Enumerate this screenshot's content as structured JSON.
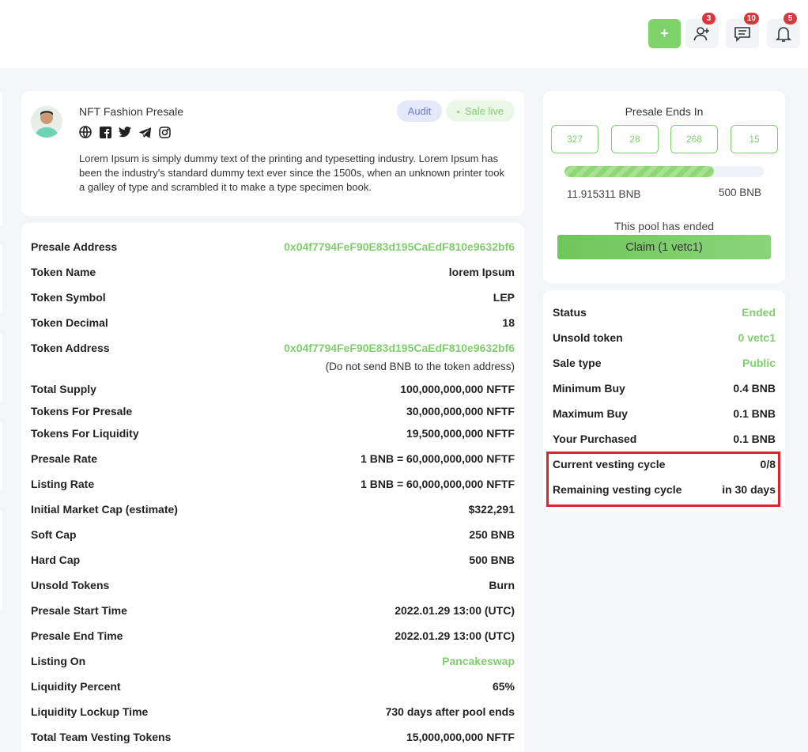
{
  "topbar": {
    "add_label": "+",
    "friend_badge": "3",
    "message_badge": "10",
    "notification_badge": "5"
  },
  "project": {
    "name": "NFT Fashion Presale",
    "audit_label": "Audit",
    "live_label": "Sale live",
    "description": "Lorem Ipsum is simply dummy text of the printing and typesetting industry. Lorem Ipsum has been the industry's standard dummy text ever since the 1500s, when an unknown printer took a galley of type and scrambled it to make a type specimen book.",
    "socials": [
      "globe-icon",
      "facebook-icon",
      "twitter-icon",
      "telegram-icon",
      "instagram-icon"
    ]
  },
  "details": {
    "rows": [
      {
        "key": "Presale Address",
        "value": "0x04f7794FeF90E83d195CaEdF810e9632bf6"
      },
      {
        "key": "Token Name",
        "value": "lorem Ipsum"
      },
      {
        "key": "Token Symbol",
        "value": "LEP"
      },
      {
        "key": "Token Decimal",
        "value": "18"
      },
      {
        "key": "Token Address",
        "value": "0x04f7794FeF90E83d195CaEdF810e9632bf6"
      },
      {
        "key": "Total Supply",
        "value": "100,000,000,000 NFTF"
      },
      {
        "key": "Tokens For Presale",
        "value": "30,000,000,000 NFTF"
      },
      {
        "key": "Tokens For Liquidity",
        "value": "19,500,000,000 NFTF"
      },
      {
        "key": "Presale Rate",
        "value": "1 BNB = 60,000,000,000 NFTF"
      },
      {
        "key": "Listing Rate",
        "value": "1 BNB = 60,000,000,000 NFTF"
      },
      {
        "key": "Initial Market Cap (estimate)",
        "value": "$322,291"
      },
      {
        "key": "Soft Cap",
        "value": "250 BNB"
      },
      {
        "key": "Hard Cap",
        "value": "500 BNB"
      },
      {
        "key": "Unsold Tokens",
        "value": "Burn"
      },
      {
        "key": "Presale Start Time",
        "value": "2022.01.29 13:00 (UTC)"
      },
      {
        "key": "Presale End Time",
        "value": "2022.01.29 13:00 (UTC)"
      },
      {
        "key": "Listing On",
        "value": "Pancakeswap"
      },
      {
        "key": "Liquidity Percent",
        "value": "65%"
      },
      {
        "key": "Liquidity Lockup Time",
        "value": "730 days after pool ends"
      },
      {
        "key": "Total Team Vesting Tokens",
        "value": "15,000,000,000 NFTF"
      }
    ],
    "token_address_note": "(Do not send BNB to the token address)"
  },
  "countdown": {
    "title": "Presale Ends In",
    "values": [
      "327",
      "28",
      "268",
      "15"
    ],
    "progress_fraction": 0.75,
    "raised": "11.915311 BNB",
    "cap": "500 BNB",
    "pool_status": "This pool has ended",
    "claim_label": "Claim (1 vetc1)"
  },
  "status": {
    "rows": [
      {
        "key": "Status",
        "value": "Ended"
      },
      {
        "key": "Unsold token",
        "value": "0 vetc1"
      },
      {
        "key": "Sale type",
        "value": "Public"
      },
      {
        "key": "Minimum Buy",
        "value": "0.4 BNB"
      },
      {
        "key": "Maximum Buy",
        "value": "0.1 BNB"
      },
      {
        "key": "Your Purchased",
        "value": "0.1 BNB"
      },
      {
        "key": "Current vesting cycle",
        "value": "0/8"
      },
      {
        "key": "Remaining vesting cycle",
        "value": "in 30 days"
      }
    ]
  },
  "colors": {
    "accent_green": "#7fce6c",
    "audit_blue": "#6c7ae0",
    "badge_red": "#d9393e",
    "highlight_red": "#e0232b"
  }
}
